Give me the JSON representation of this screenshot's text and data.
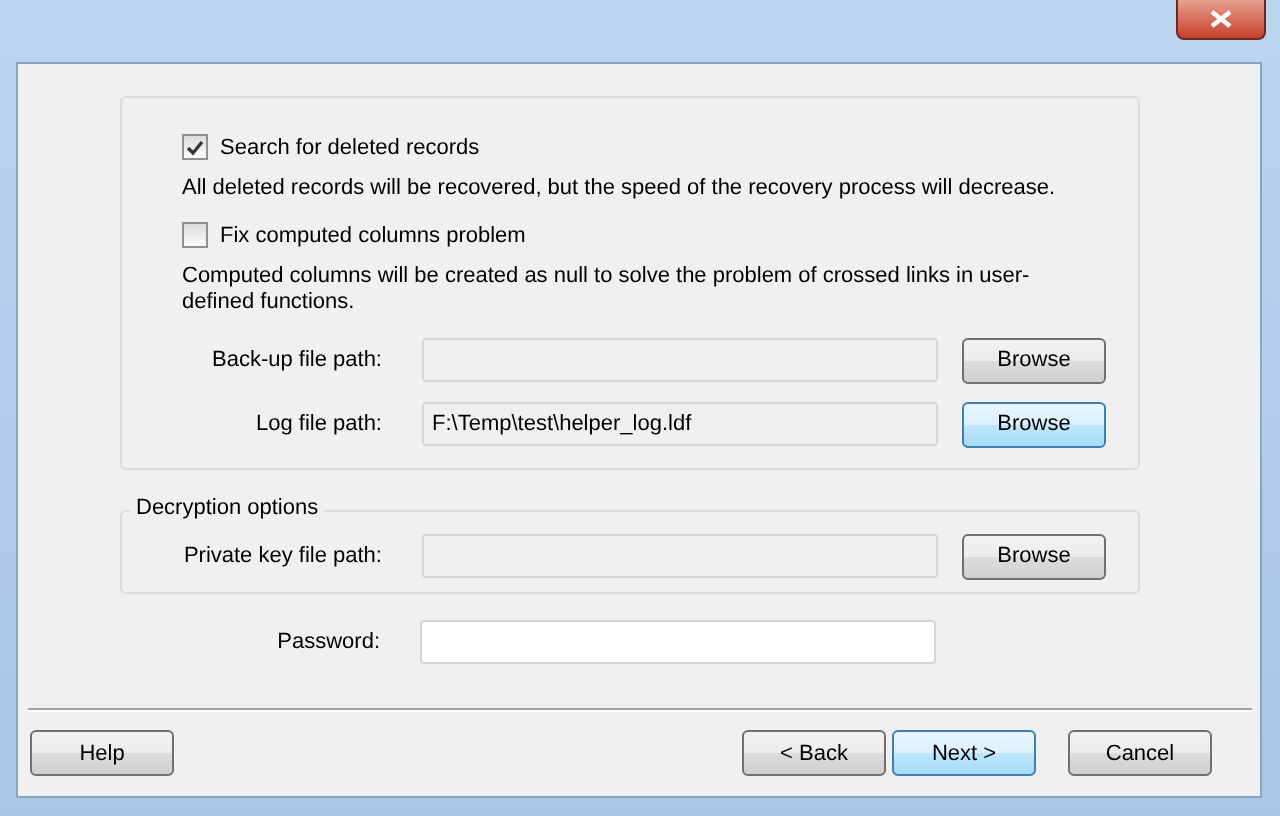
{
  "options": [
    {
      "kind": "checkbox",
      "label": "Search for deleted records",
      "checked": true,
      "description": "All deleted records will be recovered, but the speed of the recovery process will decrease."
    },
    {
      "kind": "checkbox",
      "label": "Fix computed columns problem",
      "checked": false,
      "description": "Computed columns will be created as null to solve the problem of crossed links in user-defined functions."
    }
  ],
  "file_paths": [
    {
      "label": "Back-up file path:",
      "editable": false,
      "button": {
        "label": "Browse",
        "focused": false
      }
    },
    {
      "label": "Log file path:",
      "value": "F:\\Temp\\test\\helper_log.ldf",
      "editable": false,
      "button": {
        "label": "Browse",
        "focused": true
      }
    }
  ],
  "decryption": {
    "legend": "Decryption options",
    "fields": [
      {
        "label": "Private key file path:",
        "editable": false,
        "button": {
          "label": "Browse",
          "focused": false
        }
      }
    ]
  },
  "password": {
    "label": "Password:",
    "editable": true
  },
  "footer": {
    "left_buttons": [
      {
        "label": "Help",
        "focused": false
      }
    ],
    "right_buttons": [
      {
        "label": "< Back",
        "focused": false
      },
      {
        "label": "Next >",
        "focused": true
      },
      {
        "label": "Cancel",
        "focused": false
      }
    ]
  }
}
